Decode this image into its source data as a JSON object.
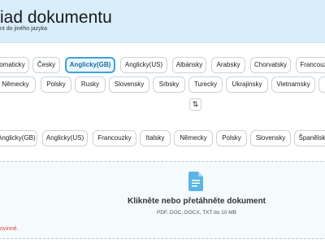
{
  "header": {
    "title": "iad dokumentu",
    "subtitle": "nt do jiného jazyka"
  },
  "source_languages": {
    "row1": [
      "omaticky",
      "Česky",
      "Anglicky(GB)",
      "Anglicky(US)",
      "Albánsky",
      "Arabsky",
      "Chorvatsky",
      "Francouz"
    ],
    "row2": [
      "Německy",
      "Polsky",
      "Rusky",
      "Slovensky",
      "Srbsky",
      "Turecky",
      "Ukrajinsky",
      "Vietnamsky",
      ""
    ],
    "selected": "Anglicky(GB)"
  },
  "swap_button": {
    "symbol": "⇅"
  },
  "target_languages": {
    "items": [
      "Anglicky(GB)",
      "Anglicky(US)",
      "Francouzky",
      "Italsky",
      "Německy",
      "Polsky",
      "Slovensky",
      "Španělsk"
    ]
  },
  "dropzone": {
    "title": "Klikněte nebo přetáhněte dokument",
    "hint": "PDF, DOC, DOCX, TXT do 10 MB",
    "icon": "document-icon",
    "icon_color": "#5ab4e5"
  },
  "error": {
    "text": "ovinné."
  },
  "colors": {
    "accent": "#3fa3d8",
    "header_bg": "#d9eefa",
    "error": "#e0403a"
  }
}
